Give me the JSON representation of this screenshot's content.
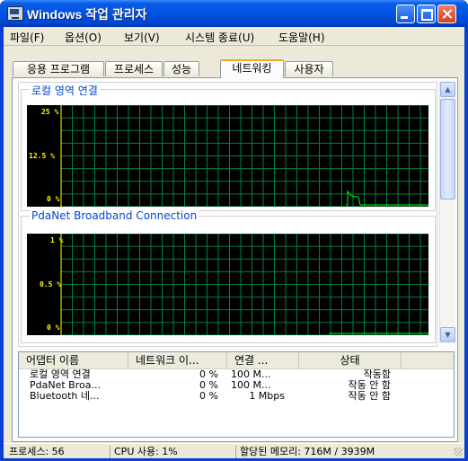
{
  "window": {
    "title": "Windows 작업 관리자"
  },
  "menu": [
    "파일(F)",
    "옵션(O)",
    "보기(V)",
    "시스템 종료(U)",
    "도움말(H)"
  ],
  "tabs": [
    {
      "label": "응용 프로그램",
      "active": false
    },
    {
      "label": "프로세스",
      "active": false
    },
    {
      "label": "성능",
      "active": false
    },
    {
      "label": "네트워킹",
      "active": true
    },
    {
      "label": "사용자",
      "active": false
    }
  ],
  "graphs": [
    {
      "label": "로컬 영역 연결",
      "y_ticks": [
        "25 %",
        "12.5 %",
        "0 %"
      ]
    },
    {
      "label": "PdaNet Broadband Connection",
      "y_ticks": [
        "1 %",
        "0.5 %",
        "0 %"
      ]
    }
  ],
  "adapters": {
    "columns": [
      "어댑터 이름",
      "네트워크 이...",
      "연결 ...",
      "상태"
    ],
    "rows": [
      [
        "로컬 영역 연결",
        "0 %",
        "100 M...",
        "작동함"
      ],
      [
        "PdaNet Broa...",
        "0 %",
        "100 M...",
        "작동 안 함"
      ],
      [
        "Bluetooth 네...",
        "0 %",
        "1 Mbps",
        "작동 안 함"
      ]
    ]
  },
  "status": {
    "processes": "프로세스: 56",
    "cpu": "CPU 사용: 1%",
    "memory": "할당된 메모리: 716M / 3939M"
  },
  "colors": {
    "graph_bg": "#000000",
    "grid": "#008040",
    "trace": "#00ff00",
    "axis": "#ffff00",
    "label": "#0046d5"
  },
  "chart_data": [
    {
      "type": "line",
      "title": "로컬 영역 연결",
      "ylim": [
        0,
        25
      ],
      "unit": "%",
      "description_values": "mostly 0 with small spike near right",
      "values": [
        0.0,
        0.0,
        0.0,
        3.5,
        2.2,
        2.0,
        0.0,
        0.0,
        0.0,
        0.0
      ]
    },
    {
      "type": "line",
      "title": "PdaNet Broadband Connection",
      "ylim": [
        0,
        1
      ],
      "unit": "%",
      "values": [
        0.0,
        0.0,
        0.0,
        0.0,
        0.0
      ]
    }
  ]
}
